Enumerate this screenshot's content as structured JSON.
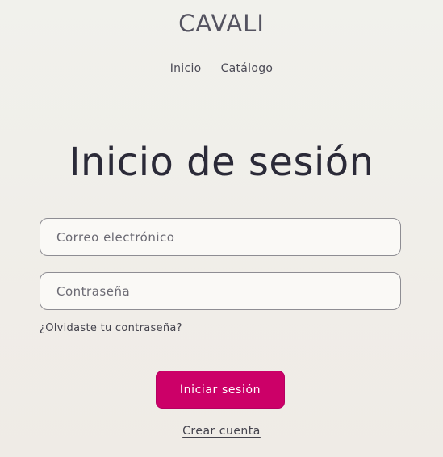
{
  "header": {
    "brand": "CAVALI",
    "nav": [
      {
        "label": "Inicio"
      },
      {
        "label": "Catálogo"
      }
    ]
  },
  "login": {
    "title": "Inicio de sesión",
    "email_placeholder": "Correo electrónico",
    "password_placeholder": "Contraseña",
    "forgot_link": "¿Olvidaste tu contraseña?",
    "submit_label": "Iniciar sesión",
    "create_account_link": "Crear cuenta"
  },
  "colors": {
    "accent": "#cc0068",
    "text": "#2b2a33"
  }
}
